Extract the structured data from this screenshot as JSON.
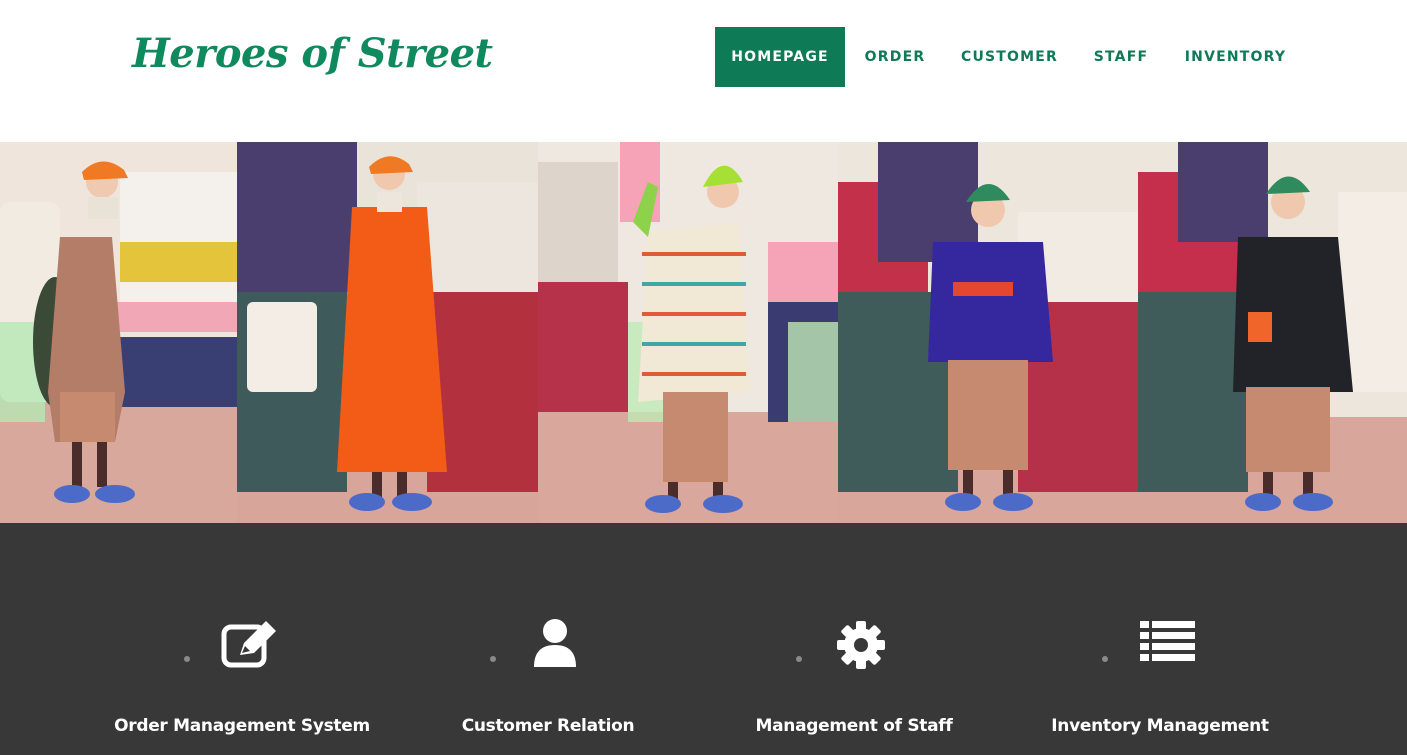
{
  "brand": {
    "logo_text": "Heroes of Street",
    "color": "#0f7a56"
  },
  "nav": {
    "items": [
      {
        "label": "HOMEPAGE",
        "active": true
      },
      {
        "label": "ORDER",
        "active": false
      },
      {
        "label": "CUSTOMER",
        "active": false
      },
      {
        "label": "STAFF",
        "active": false
      },
      {
        "label": "INVENTORY",
        "active": false
      }
    ]
  },
  "banner": {
    "photos": [
      {
        "icon": "outfit-photo-plaid-coat-orange-cap"
      },
      {
        "icon": "outfit-photo-orange-long-coat"
      },
      {
        "icon": "outfit-photo-striped-sweater-green-beanie"
      },
      {
        "icon": "outfit-photo-purple-hoodie-green-beanie"
      },
      {
        "icon": "outfit-photo-black-bomber-green-beanie"
      }
    ]
  },
  "features": {
    "items": [
      {
        "label": "Order Management System",
        "icon": "edit-icon"
      },
      {
        "label": "Customer Relation",
        "icon": "user-icon"
      },
      {
        "label": "Management of Staff",
        "icon": "gear-icon"
      },
      {
        "label": "Inventory Management",
        "icon": "list-icon"
      }
    ],
    "background": "#383838"
  }
}
